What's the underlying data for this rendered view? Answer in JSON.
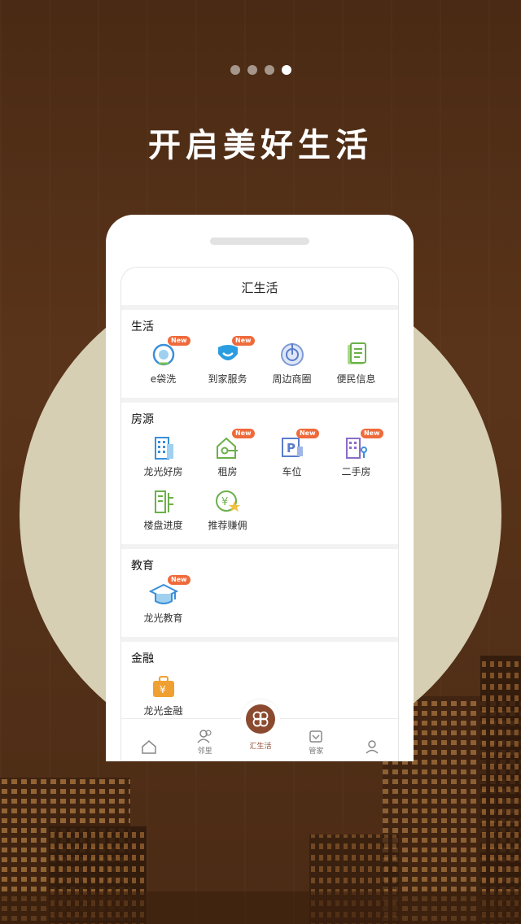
{
  "headline": "开启美好生活",
  "pager": {
    "count": 4,
    "active_index": 3
  },
  "app_title": "汇生活",
  "badge_text": "New",
  "sections": [
    {
      "title": "生活",
      "items": [
        {
          "label": "e袋洗",
          "icon": "laundry-icon",
          "new": true
        },
        {
          "label": "到家服务",
          "icon": "home-service-icon",
          "new": true
        },
        {
          "label": "周边商圈",
          "icon": "nearby-business-icon",
          "new": false
        },
        {
          "label": "便民信息",
          "icon": "community-info-icon",
          "new": false
        }
      ]
    },
    {
      "title": "房源",
      "items": [
        {
          "label": "龙光好房",
          "icon": "building-icon",
          "new": false
        },
        {
          "label": "租房",
          "icon": "rental-icon",
          "new": true
        },
        {
          "label": "车位",
          "icon": "parking-icon",
          "new": true
        },
        {
          "label": "二手房",
          "icon": "second-hand-house-icon",
          "new": true
        },
        {
          "label": "楼盘进度",
          "icon": "construction-progress-icon",
          "new": false
        },
        {
          "label": "推荐赚佣",
          "icon": "referral-commission-icon",
          "new": false
        }
      ]
    },
    {
      "title": "教育",
      "items": [
        {
          "label": "龙光教育",
          "icon": "graduation-cap-icon",
          "new": true
        }
      ]
    },
    {
      "title": "金融",
      "items": [
        {
          "label": "龙光金融",
          "icon": "finance-briefcase-icon",
          "new": false
        }
      ]
    }
  ],
  "tabbar": {
    "items": [
      {
        "label": "",
        "icon": "home-icon"
      },
      {
        "label": "邻里",
        "icon": "neighbors-icon"
      },
      {
        "label": "汇生活",
        "icon": "clover-icon",
        "active": true
      },
      {
        "label": "管家",
        "icon": "butler-icon"
      },
      {
        "label": "",
        "icon": "profile-icon"
      }
    ]
  },
  "colors": {
    "background": "#4f2d16",
    "circle": "#d6cfb3",
    "accent": "#8b4a2f",
    "badge": "#ef6a3b",
    "icon_blue": "#3b8fd9",
    "icon_green": "#7bbf5a",
    "icon_orange": "#f0a030"
  }
}
